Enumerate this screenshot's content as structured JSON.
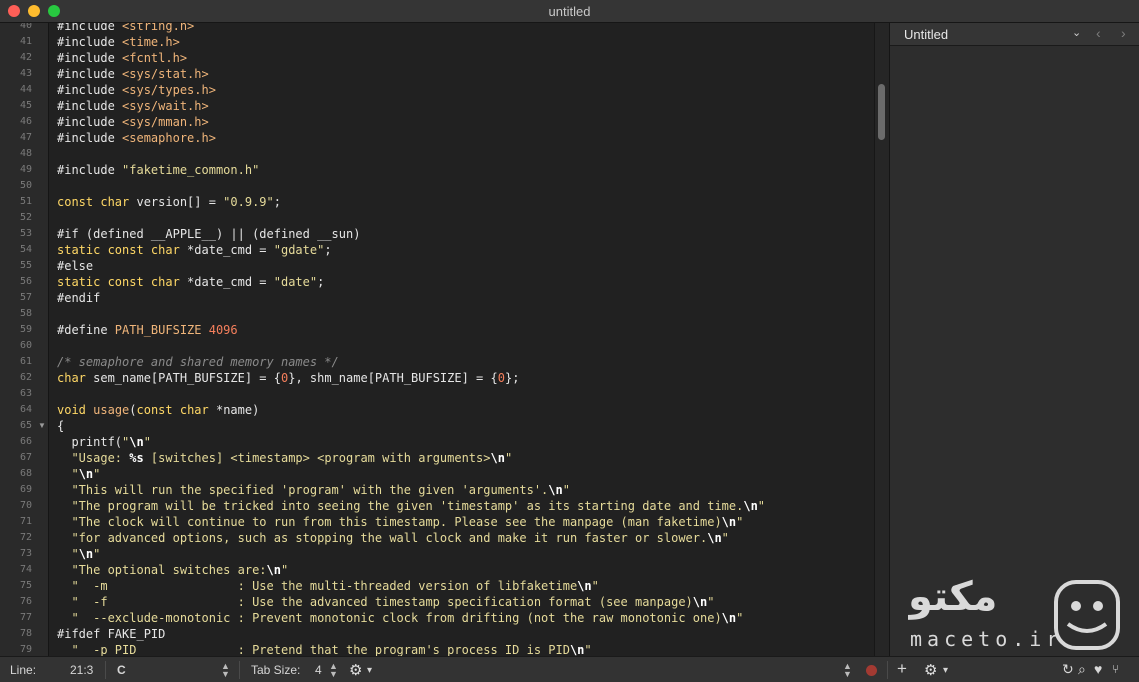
{
  "window": {
    "title": "untitled"
  },
  "gutter": {
    "lines": [
      {
        "n": "40",
        "fold": ""
      },
      {
        "n": "41",
        "fold": ""
      },
      {
        "n": "42",
        "fold": ""
      },
      {
        "n": "43",
        "fold": ""
      },
      {
        "n": "44",
        "fold": ""
      },
      {
        "n": "45",
        "fold": ""
      },
      {
        "n": "46",
        "fold": ""
      },
      {
        "n": "47",
        "fold": ""
      },
      {
        "n": "48",
        "fold": ""
      },
      {
        "n": "49",
        "fold": ""
      },
      {
        "n": "50",
        "fold": ""
      },
      {
        "n": "51",
        "fold": ""
      },
      {
        "n": "52",
        "fold": ""
      },
      {
        "n": "53",
        "fold": ""
      },
      {
        "n": "54",
        "fold": ""
      },
      {
        "n": "55",
        "fold": ""
      },
      {
        "n": "56",
        "fold": ""
      },
      {
        "n": "57",
        "fold": ""
      },
      {
        "n": "58",
        "fold": ""
      },
      {
        "n": "59",
        "fold": ""
      },
      {
        "n": "60",
        "fold": ""
      },
      {
        "n": "61",
        "fold": ""
      },
      {
        "n": "62",
        "fold": ""
      },
      {
        "n": "63",
        "fold": ""
      },
      {
        "n": "64",
        "fold": ""
      },
      {
        "n": "65",
        "fold": "▼"
      },
      {
        "n": "66",
        "fold": ""
      },
      {
        "n": "67",
        "fold": ""
      },
      {
        "n": "68",
        "fold": ""
      },
      {
        "n": "69",
        "fold": ""
      },
      {
        "n": "70",
        "fold": ""
      },
      {
        "n": "71",
        "fold": ""
      },
      {
        "n": "72",
        "fold": ""
      },
      {
        "n": "73",
        "fold": ""
      },
      {
        "n": "74",
        "fold": ""
      },
      {
        "n": "75",
        "fold": ""
      },
      {
        "n": "76",
        "fold": ""
      },
      {
        "n": "77",
        "fold": ""
      },
      {
        "n": "78",
        "fold": ""
      },
      {
        "n": "79",
        "fold": ""
      }
    ]
  },
  "code": {
    "lines": [
      [
        [
          "#include ",
          ""
        ],
        [
          "<string.h>",
          "inc"
        ]
      ],
      [
        [
          "#include ",
          ""
        ],
        [
          "<time.h>",
          "inc"
        ]
      ],
      [
        [
          "#include ",
          ""
        ],
        [
          "<fcntl.h>",
          "inc"
        ]
      ],
      [
        [
          "#include ",
          ""
        ],
        [
          "<sys/stat.h>",
          "inc"
        ]
      ],
      [
        [
          "#include ",
          ""
        ],
        [
          "<sys/types.h>",
          "inc"
        ]
      ],
      [
        [
          "#include ",
          ""
        ],
        [
          "<sys/wait.h>",
          "inc"
        ]
      ],
      [
        [
          "#include ",
          ""
        ],
        [
          "<sys/mman.h>",
          "inc"
        ]
      ],
      [
        [
          "#include ",
          ""
        ],
        [
          "<semaphore.h>",
          "inc"
        ]
      ],
      [],
      [
        [
          "#include ",
          ""
        ],
        [
          "\"faketime_common.h\"",
          "str"
        ]
      ],
      [],
      [
        [
          "const char",
          "kw"
        ],
        [
          " version[] = ",
          ""
        ],
        [
          "\"0.9.9\"",
          "str"
        ],
        [
          ";",
          ""
        ]
      ],
      [],
      [
        [
          "#if (defined __APPLE__) || (defined __sun)",
          ""
        ]
      ],
      [
        [
          "static const char",
          "kw"
        ],
        [
          " *date_cmd = ",
          ""
        ],
        [
          "\"gdate\"",
          "str"
        ],
        [
          ";",
          ""
        ]
      ],
      [
        [
          "#else",
          ""
        ]
      ],
      [
        [
          "static const char",
          "kw"
        ],
        [
          " *date_cmd = ",
          ""
        ],
        [
          "\"date\"",
          "str"
        ],
        [
          ";",
          ""
        ]
      ],
      [
        [
          "#endif",
          ""
        ]
      ],
      [],
      [
        [
          "#define ",
          ""
        ],
        [
          "PATH_BUFSIZE ",
          "pre"
        ],
        [
          "4096",
          "num"
        ]
      ],
      [],
      [
        [
          "/* semaphore and shared memory names */",
          "com"
        ]
      ],
      [
        [
          "char",
          "kw"
        ],
        [
          " sem_name[PATH_BUFSIZE] = {",
          ""
        ],
        [
          "0",
          "num"
        ],
        [
          "}, shm_name[PATH_BUFSIZE] = {",
          ""
        ],
        [
          "0",
          "num"
        ],
        [
          "};",
          ""
        ]
      ],
      [],
      [
        [
          "void",
          "kw"
        ],
        [
          " ",
          ""
        ],
        [
          "usage",
          "fn"
        ],
        [
          "(",
          ""
        ],
        [
          "const char",
          "kw"
        ],
        [
          " *name)",
          ""
        ]
      ],
      [
        [
          "{",
          ""
        ]
      ],
      [
        [
          "  printf(",
          ""
        ],
        [
          "\"",
          "str"
        ],
        [
          "\\n",
          "esc"
        ],
        [
          "\"",
          "str"
        ]
      ],
      [
        [
          "  \"Usage: ",
          "str"
        ],
        [
          "%s",
          "esc"
        ],
        [
          " [switches] <timestamp> <program with arguments>",
          "str"
        ],
        [
          "\\n",
          "esc"
        ],
        [
          "\"",
          "str"
        ]
      ],
      [
        [
          "  \"",
          "str"
        ],
        [
          "\\n",
          "esc"
        ],
        [
          "\"",
          "str"
        ]
      ],
      [
        [
          "  \"This will run the specified 'program' with the given 'arguments'.",
          "str"
        ],
        [
          "\\n",
          "esc"
        ],
        [
          "\"",
          "str"
        ]
      ],
      [
        [
          "  \"The program will be tricked into seeing the given 'timestamp' as its starting date and time.",
          "str"
        ],
        [
          "\\n",
          "esc"
        ],
        [
          "\"",
          "str"
        ]
      ],
      [
        [
          "  \"The clock will continue to run from this timestamp. Please see the manpage (man faketime)",
          "str"
        ],
        [
          "\\n",
          "esc"
        ],
        [
          "\"",
          "str"
        ]
      ],
      [
        [
          "  \"for advanced options, such as stopping the wall clock and make it run faster or slower.",
          "str"
        ],
        [
          "\\n",
          "esc"
        ],
        [
          "\"",
          "str"
        ]
      ],
      [
        [
          "  \"",
          "str"
        ],
        [
          "\\n",
          "esc"
        ],
        [
          "\"",
          "str"
        ]
      ],
      [
        [
          "  \"The optional switches are:",
          "str"
        ],
        [
          "\\n",
          "esc"
        ],
        [
          "\"",
          "str"
        ]
      ],
      [
        [
          "  \"  -m                  : Use the multi-threaded version of libfaketime",
          "str"
        ],
        [
          "\\n",
          "esc"
        ],
        [
          "\"",
          "str"
        ]
      ],
      [
        [
          "  \"  -f                  : Use the advanced timestamp specification format (see manpage)",
          "str"
        ],
        [
          "\\n",
          "esc"
        ],
        [
          "\"",
          "str"
        ]
      ],
      [
        [
          "  \"  --exclude-monotonic : Prevent monotonic clock from drifting (not the raw monotonic one)",
          "str"
        ],
        [
          "\\n",
          "esc"
        ],
        [
          "\"",
          "str"
        ]
      ],
      [
        [
          "#ifdef FAKE_PID",
          ""
        ]
      ],
      [
        [
          "  \"  -p PID              : Pretend that the program's process ID is PID",
          "str"
        ],
        [
          "\\n",
          "esc"
        ],
        [
          "\"",
          "str"
        ]
      ]
    ]
  },
  "sidebar": {
    "title": "Untitled",
    "prev_icon": "chevron-left-icon",
    "next_icon": "chevron-right-icon",
    "watermark_text": "مکتو",
    "watermark_url": "maceto.ir"
  },
  "status": {
    "line_label": "Line:",
    "position": "21:3",
    "language": "C",
    "tab_size_label": "Tab Size:",
    "tab_size": "4"
  },
  "colors": {
    "keyword": "#ffd866",
    "string": "#e6db9a",
    "number": "#f57f5c",
    "include": "#f0b57a"
  }
}
